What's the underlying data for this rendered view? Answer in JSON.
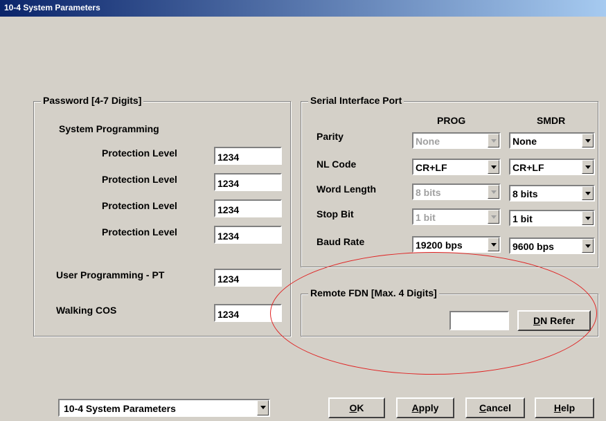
{
  "window": {
    "title": "10-4 System Parameters"
  },
  "password_group": {
    "legend": "Password [4-7 Digits]",
    "system_programming_label": "System Programming",
    "protection_levels": [
      {
        "label": "Protection Level",
        "value": "1234"
      },
      {
        "label": "Protection Level",
        "value": "1234"
      },
      {
        "label": "Protection Level",
        "value": "1234"
      },
      {
        "label": "Protection Level",
        "value": "1234"
      }
    ],
    "user_programming_label": "User Programming - PT",
    "user_programming_value": "1234",
    "walking_cos_label": "Walking COS",
    "walking_cos_value": "1234"
  },
  "serial_group": {
    "legend": "Serial Interface Port",
    "col_prog": "PROG",
    "col_smdr": "SMDR",
    "rows": [
      {
        "label": "Parity",
        "prog": "None",
        "prog_enabled": false,
        "smdr": "None"
      },
      {
        "label": "NL Code",
        "prog": "CR+LF",
        "prog_enabled": true,
        "smdr": "CR+LF"
      },
      {
        "label": "Word Length",
        "prog": "8 bits",
        "prog_enabled": false,
        "smdr": "8 bits"
      },
      {
        "label": "Stop Bit",
        "prog": "1 bit",
        "prog_enabled": false,
        "smdr": "1 bit"
      },
      {
        "label": "Baud Rate",
        "prog": "19200 bps",
        "prog_enabled": true,
        "smdr": "9600 bps"
      }
    ]
  },
  "remote_fdn_group": {
    "legend": "Remote FDN [Max. 4 Digits]",
    "value": "",
    "dn_refer_label_underlined": "D",
    "dn_refer_label_rest": "N Refer"
  },
  "footer": {
    "screen_select_value": "10-4 System Parameters",
    "ok": {
      "u": "O",
      "rest": "K"
    },
    "apply": {
      "u": "A",
      "rest": "pply"
    },
    "cancel": {
      "u": "C",
      "rest": "ancel"
    },
    "help": {
      "u": "H",
      "rest": "elp"
    }
  },
  "annotation": {
    "oval_color": "#e02020"
  }
}
